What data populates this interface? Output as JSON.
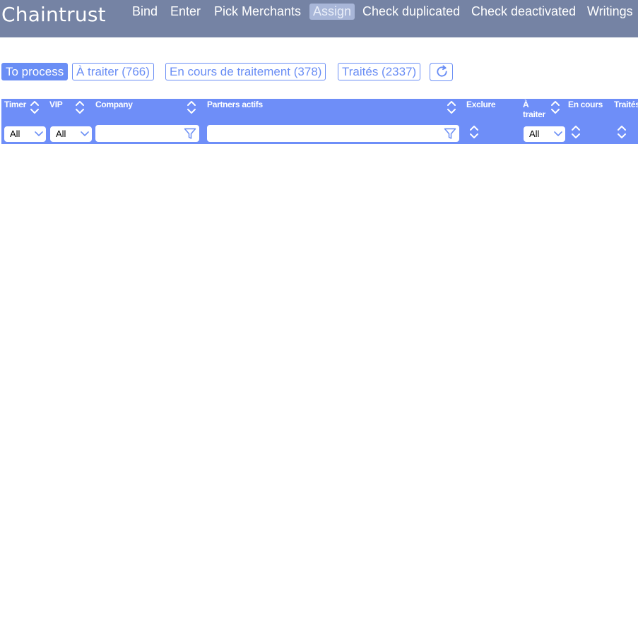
{
  "navbar": {
    "brand": "Chaintrust",
    "items": [
      {
        "label": "Bind",
        "active": false
      },
      {
        "label": "Enter",
        "active": false
      },
      {
        "label": "Pick Merchants",
        "active": false
      },
      {
        "label": "Assign",
        "active": true
      },
      {
        "label": "Check duplicated",
        "active": false
      },
      {
        "label": "Check deactivated",
        "active": false
      },
      {
        "label": "Writings",
        "active": false
      }
    ]
  },
  "tabs": [
    {
      "label": "To process",
      "active": true
    },
    {
      "label": "À traiter (766)",
      "active": false
    },
    {
      "label": "En cours de traitement (378)",
      "active": false
    },
    {
      "label": "Traités (2337)",
      "active": false
    }
  ],
  "refresh": {
    "icon": "refresh-icon"
  },
  "table": {
    "columns": [
      {
        "title": "Timer",
        "filter": "select",
        "filter_value": "All"
      },
      {
        "title": "VIP",
        "filter": "select",
        "filter_value": "All"
      },
      {
        "title": "Company",
        "filter": "text",
        "filter_value": ""
      },
      {
        "title": "Partners actifs",
        "filter": "text",
        "filter_value": ""
      },
      {
        "title": "Exclure",
        "filter": "none"
      },
      {
        "title": "À traiter",
        "filter": "select",
        "filter_value": "All"
      },
      {
        "title": "En cours",
        "filter": "none"
      },
      {
        "title": "Traités",
        "filter": "none"
      }
    ],
    "rows": []
  },
  "colors": {
    "navbar_bg": "#7583a4",
    "accent": "#6a8ef5",
    "table_header_bg": "#6e8ef8"
  }
}
